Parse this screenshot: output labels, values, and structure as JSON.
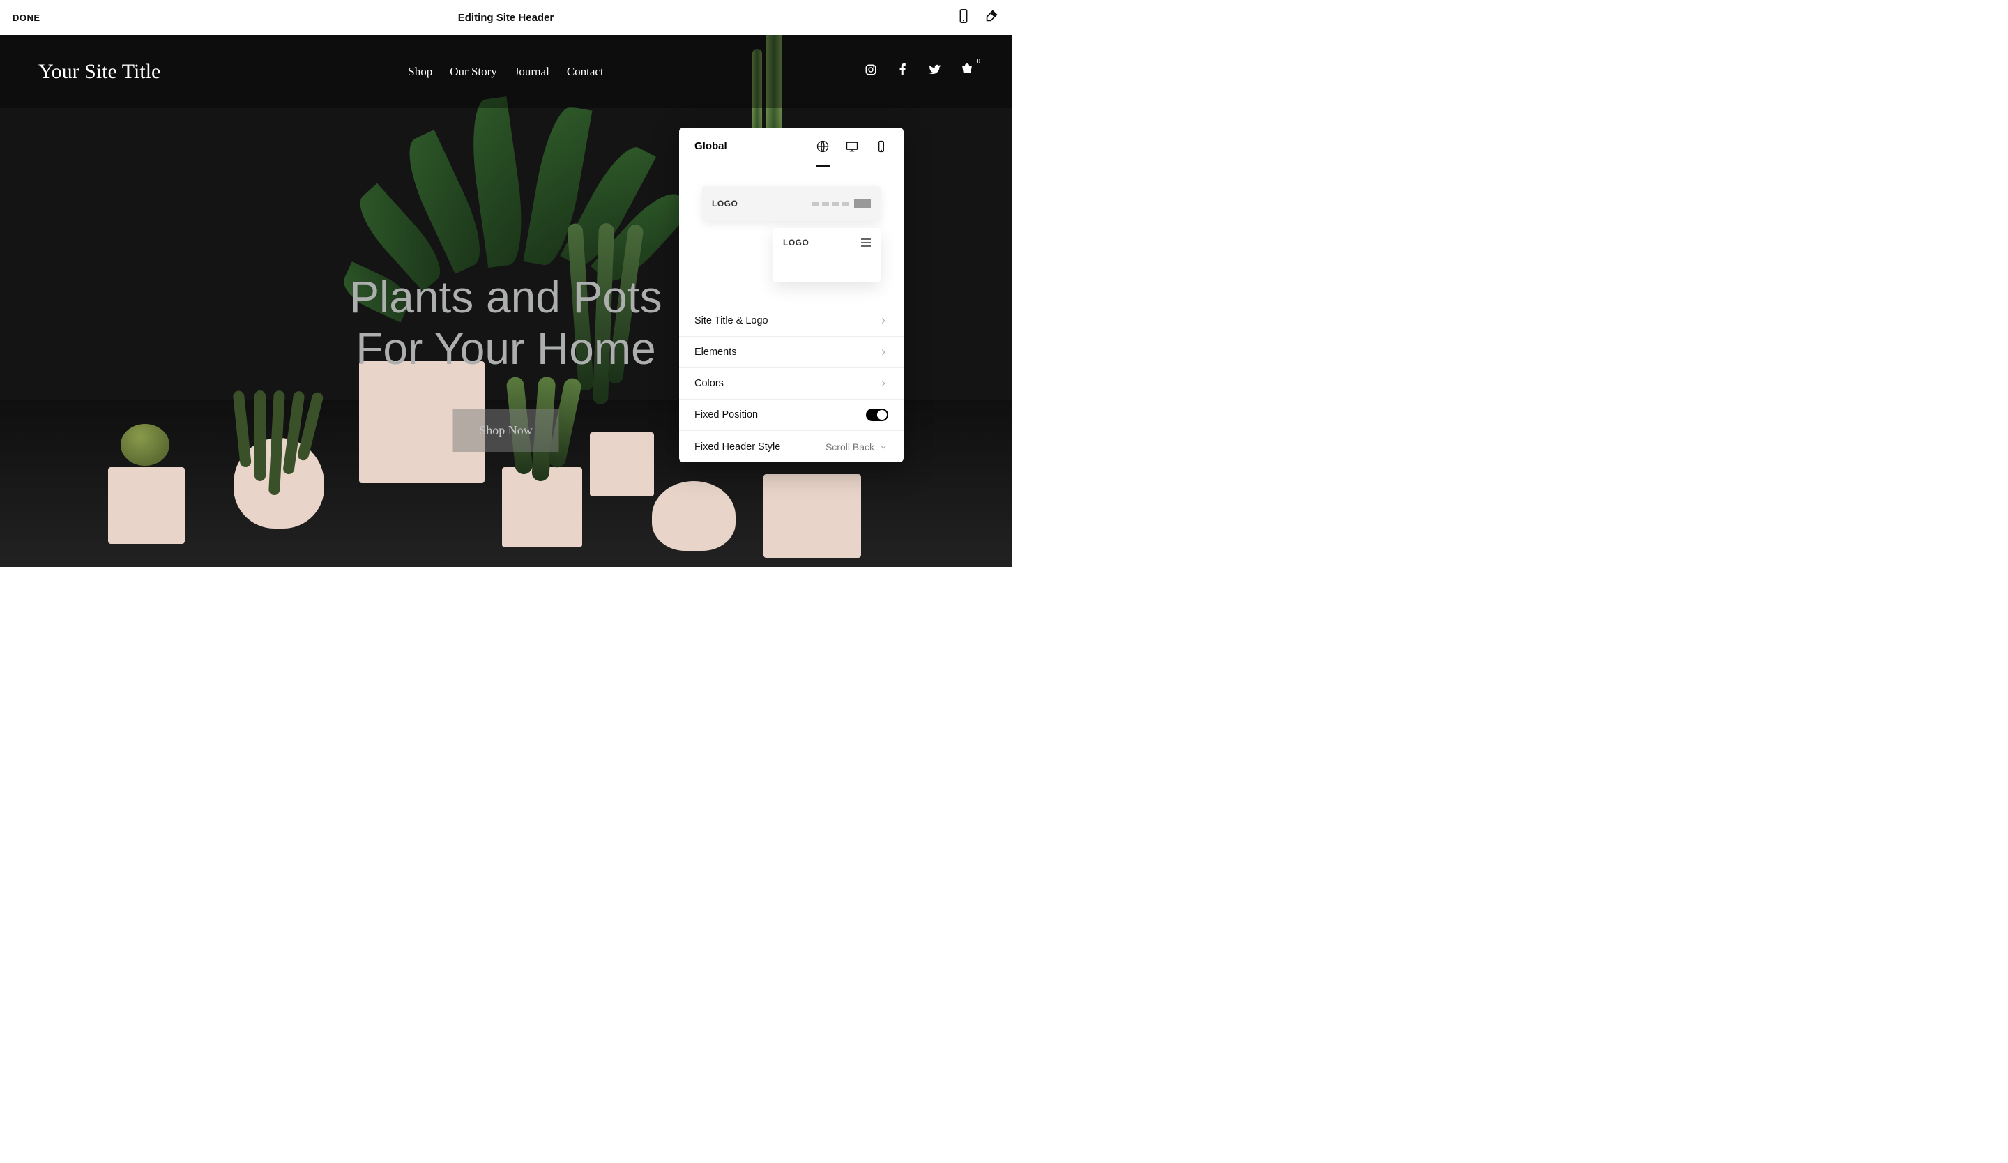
{
  "topbar": {
    "done": "DONE",
    "title": "Editing Site Header"
  },
  "site": {
    "title": "Your Site Title",
    "nav": [
      "Shop",
      "Our Story",
      "Journal",
      "Contact"
    ],
    "cart_count": "0"
  },
  "hero": {
    "line1": "Plants and Pots",
    "line2": "For Your Home",
    "button": "Shop Now"
  },
  "panel": {
    "tab": "Global",
    "logo_label": "LOGO",
    "logo_label2": "LOGO",
    "rows": {
      "site_title_logo": "Site Title & Logo",
      "elements": "Elements",
      "colors": "Colors",
      "fixed_position": "Fixed Position",
      "fixed_header_style": "Fixed Header Style",
      "fixed_header_style_value": "Scroll Back"
    }
  }
}
